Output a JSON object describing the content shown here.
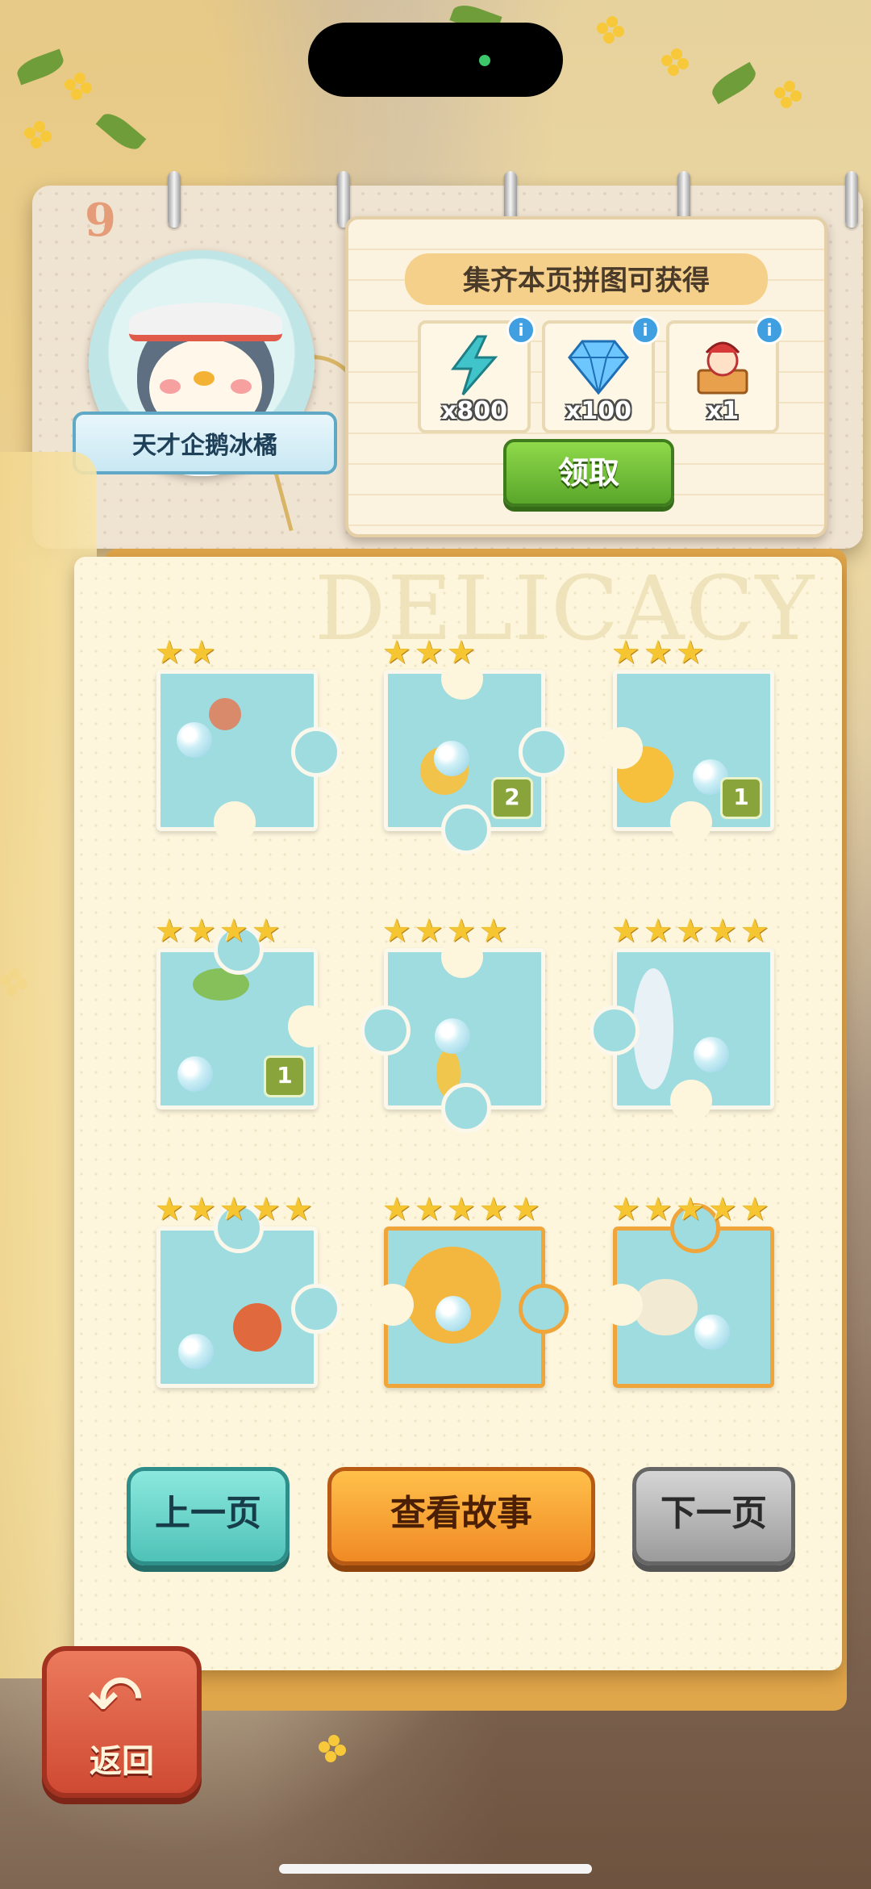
{
  "page": {
    "number": "9",
    "badge_title": "天才企鹅冰橘",
    "watermark": "DELICACY"
  },
  "rewards": {
    "title": "集齐本页拼图可获得",
    "items": [
      {
        "icon": "lightning-energy-icon",
        "qty": "x800",
        "info": "i"
      },
      {
        "icon": "blue-diamond-icon",
        "qty": "x100",
        "info": "i"
      },
      {
        "icon": "jester-doll-chest-icon",
        "qty": "x1",
        "info": "i"
      }
    ],
    "claim_label": "领取"
  },
  "puzzle": {
    "pieces": [
      {
        "stars": 2,
        "count": ""
      },
      {
        "stars": 3,
        "count": "2"
      },
      {
        "stars": 3,
        "count": "1"
      },
      {
        "stars": 4,
        "count": "1"
      },
      {
        "stars": 4,
        "count": ""
      },
      {
        "stars": 5,
        "count": ""
      },
      {
        "stars": 5,
        "count": ""
      },
      {
        "stars": 5,
        "count": ""
      },
      {
        "stars": 5,
        "count": ""
      }
    ]
  },
  "nav": {
    "prev_label": "上一页",
    "story_label": "查看故事",
    "next_label": "下一页",
    "back_label": "返回"
  },
  "colors": {
    "claim_green": "#5aa62a",
    "prev_teal": "#4fc2b7",
    "story_orange": "#f08a25",
    "next_gray": "#9b9b9b",
    "back_red": "#cf4a33",
    "star_gold": "#f6c532"
  }
}
